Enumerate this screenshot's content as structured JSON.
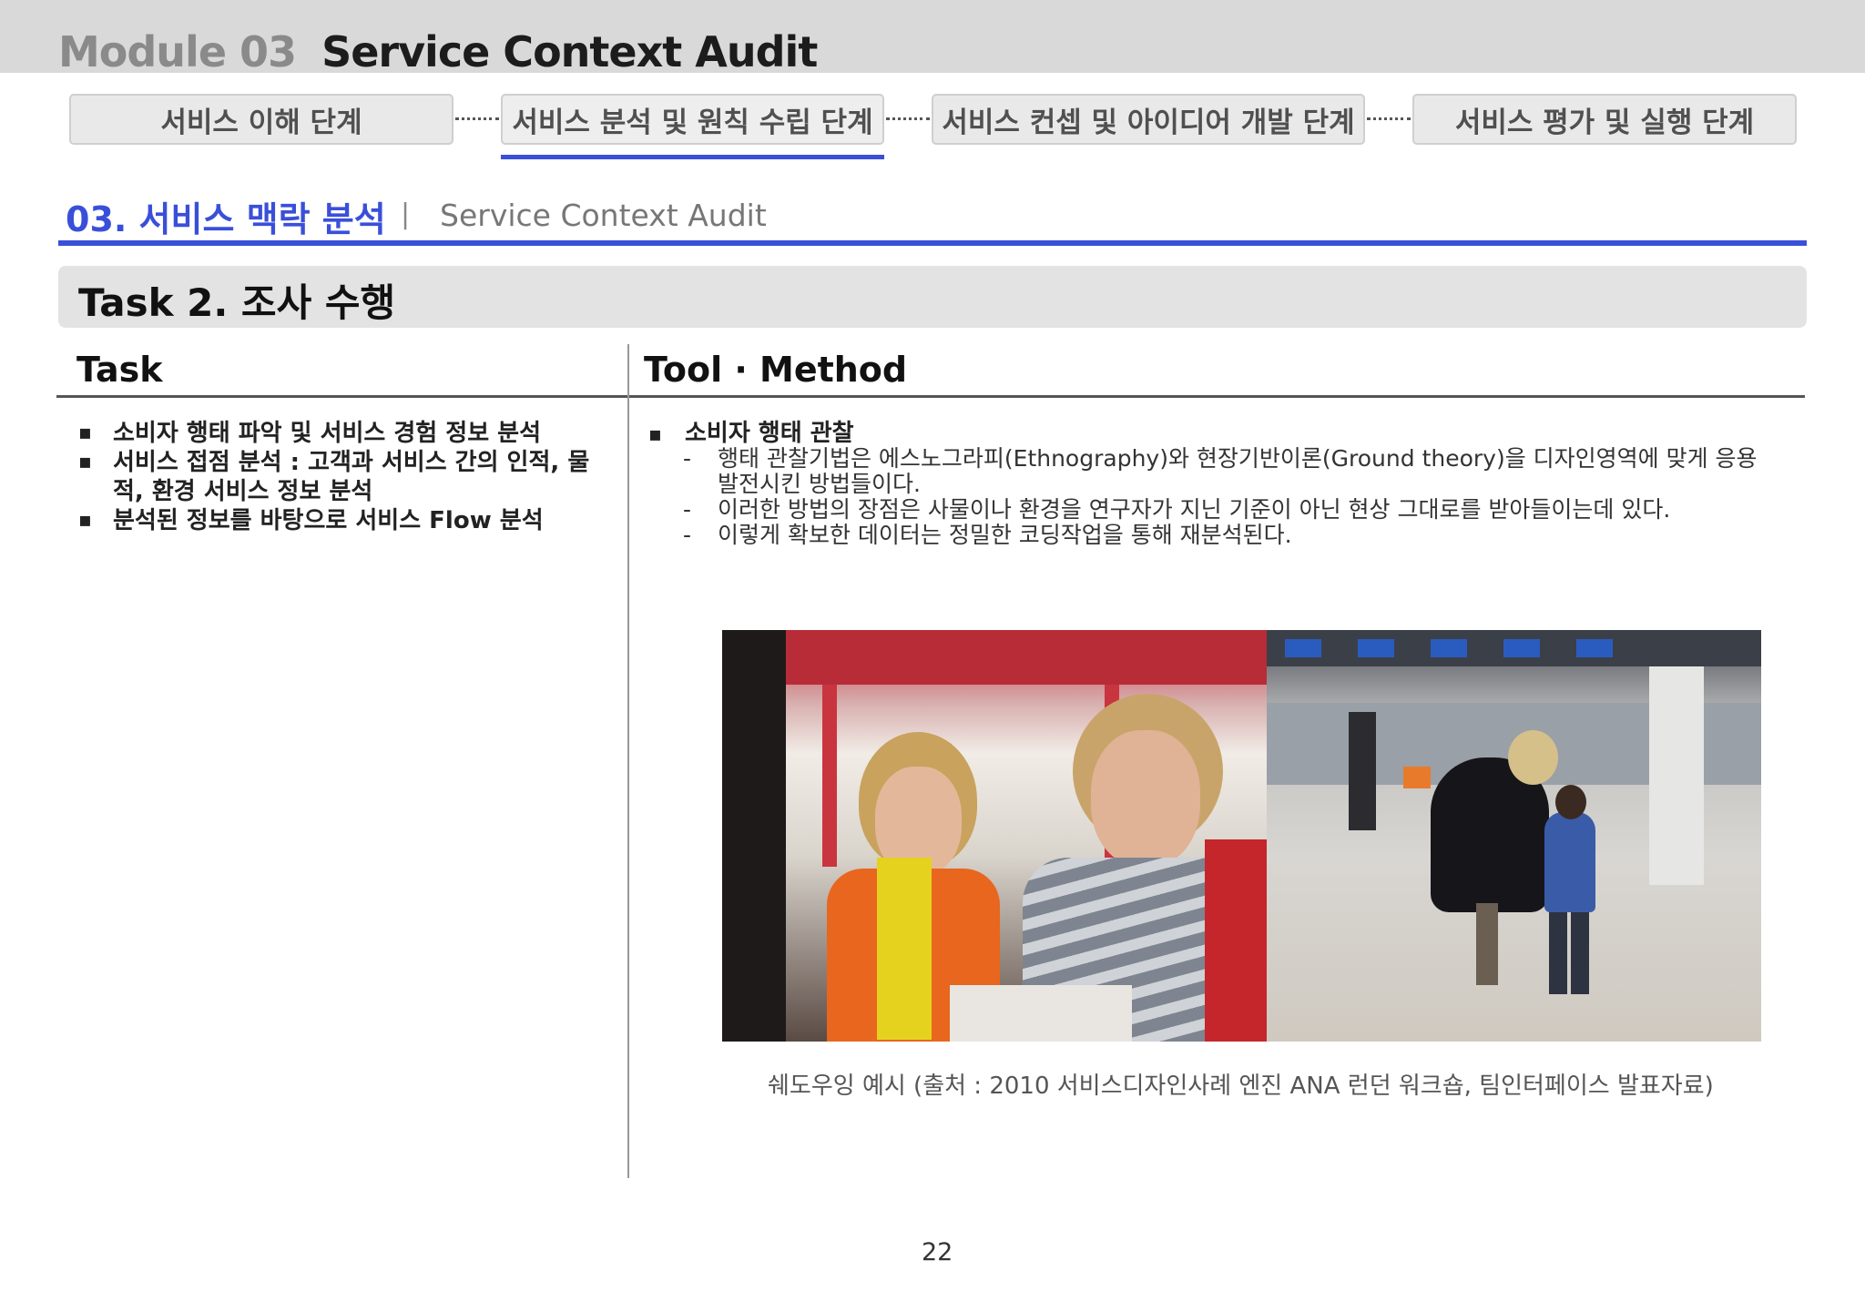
{
  "header": {
    "module_label": "Module 03",
    "module_name": "Service Context Audit"
  },
  "steps": [
    {
      "label": "서비스 이해 단계",
      "active": false
    },
    {
      "label": "서비스 분석 및 원칙 수립 단계",
      "active": true
    },
    {
      "label": "서비스 컨셉 및 아이디어 개발 단계",
      "active": false
    },
    {
      "label": "서비스 평가 및 실행 단계",
      "active": false
    }
  ],
  "section": {
    "title": "03. 서비스 맥락 분석",
    "separator": "|",
    "subtitle": "Service Context Audit"
  },
  "task": {
    "title": "Task 2. 조사 수행"
  },
  "columns": {
    "task_header": "Task",
    "tool_header": "Tool · Method"
  },
  "task_items": [
    "소비자 행태 파악 및 서비스 경험 정보 분석",
    "서비스 접점 분석 : 고객과 서비스 간의 인적, 물적, 환경 서비스 정보 분석",
    "분석된 정보를 바탕으로 서비스 Flow 분석"
  ],
  "tool": {
    "heading": "소비자 행태 관찰",
    "lines": [
      "행태 관찰기법은 에스노그라피(Ethnography)와 현장기반이론(Ground theory)을 디자인영역에 맞게 응용 발전시킨 방법들이다.",
      "이러한 방법의 장점은 사물이나 환경을 연구자가 지닌 기준이 아닌 현상 그대로를 받아들이는데 있다.",
      "이렇게 확보한 데이터는 정밀한 코딩작업을 통해 재분석된다."
    ]
  },
  "caption": "쉐도우잉 예시 (출처 : 2010 서비스디자인사례 엔진 ANA 런던 워크숍, 팀인터페이스 발표자료)",
  "page_number": "22"
}
